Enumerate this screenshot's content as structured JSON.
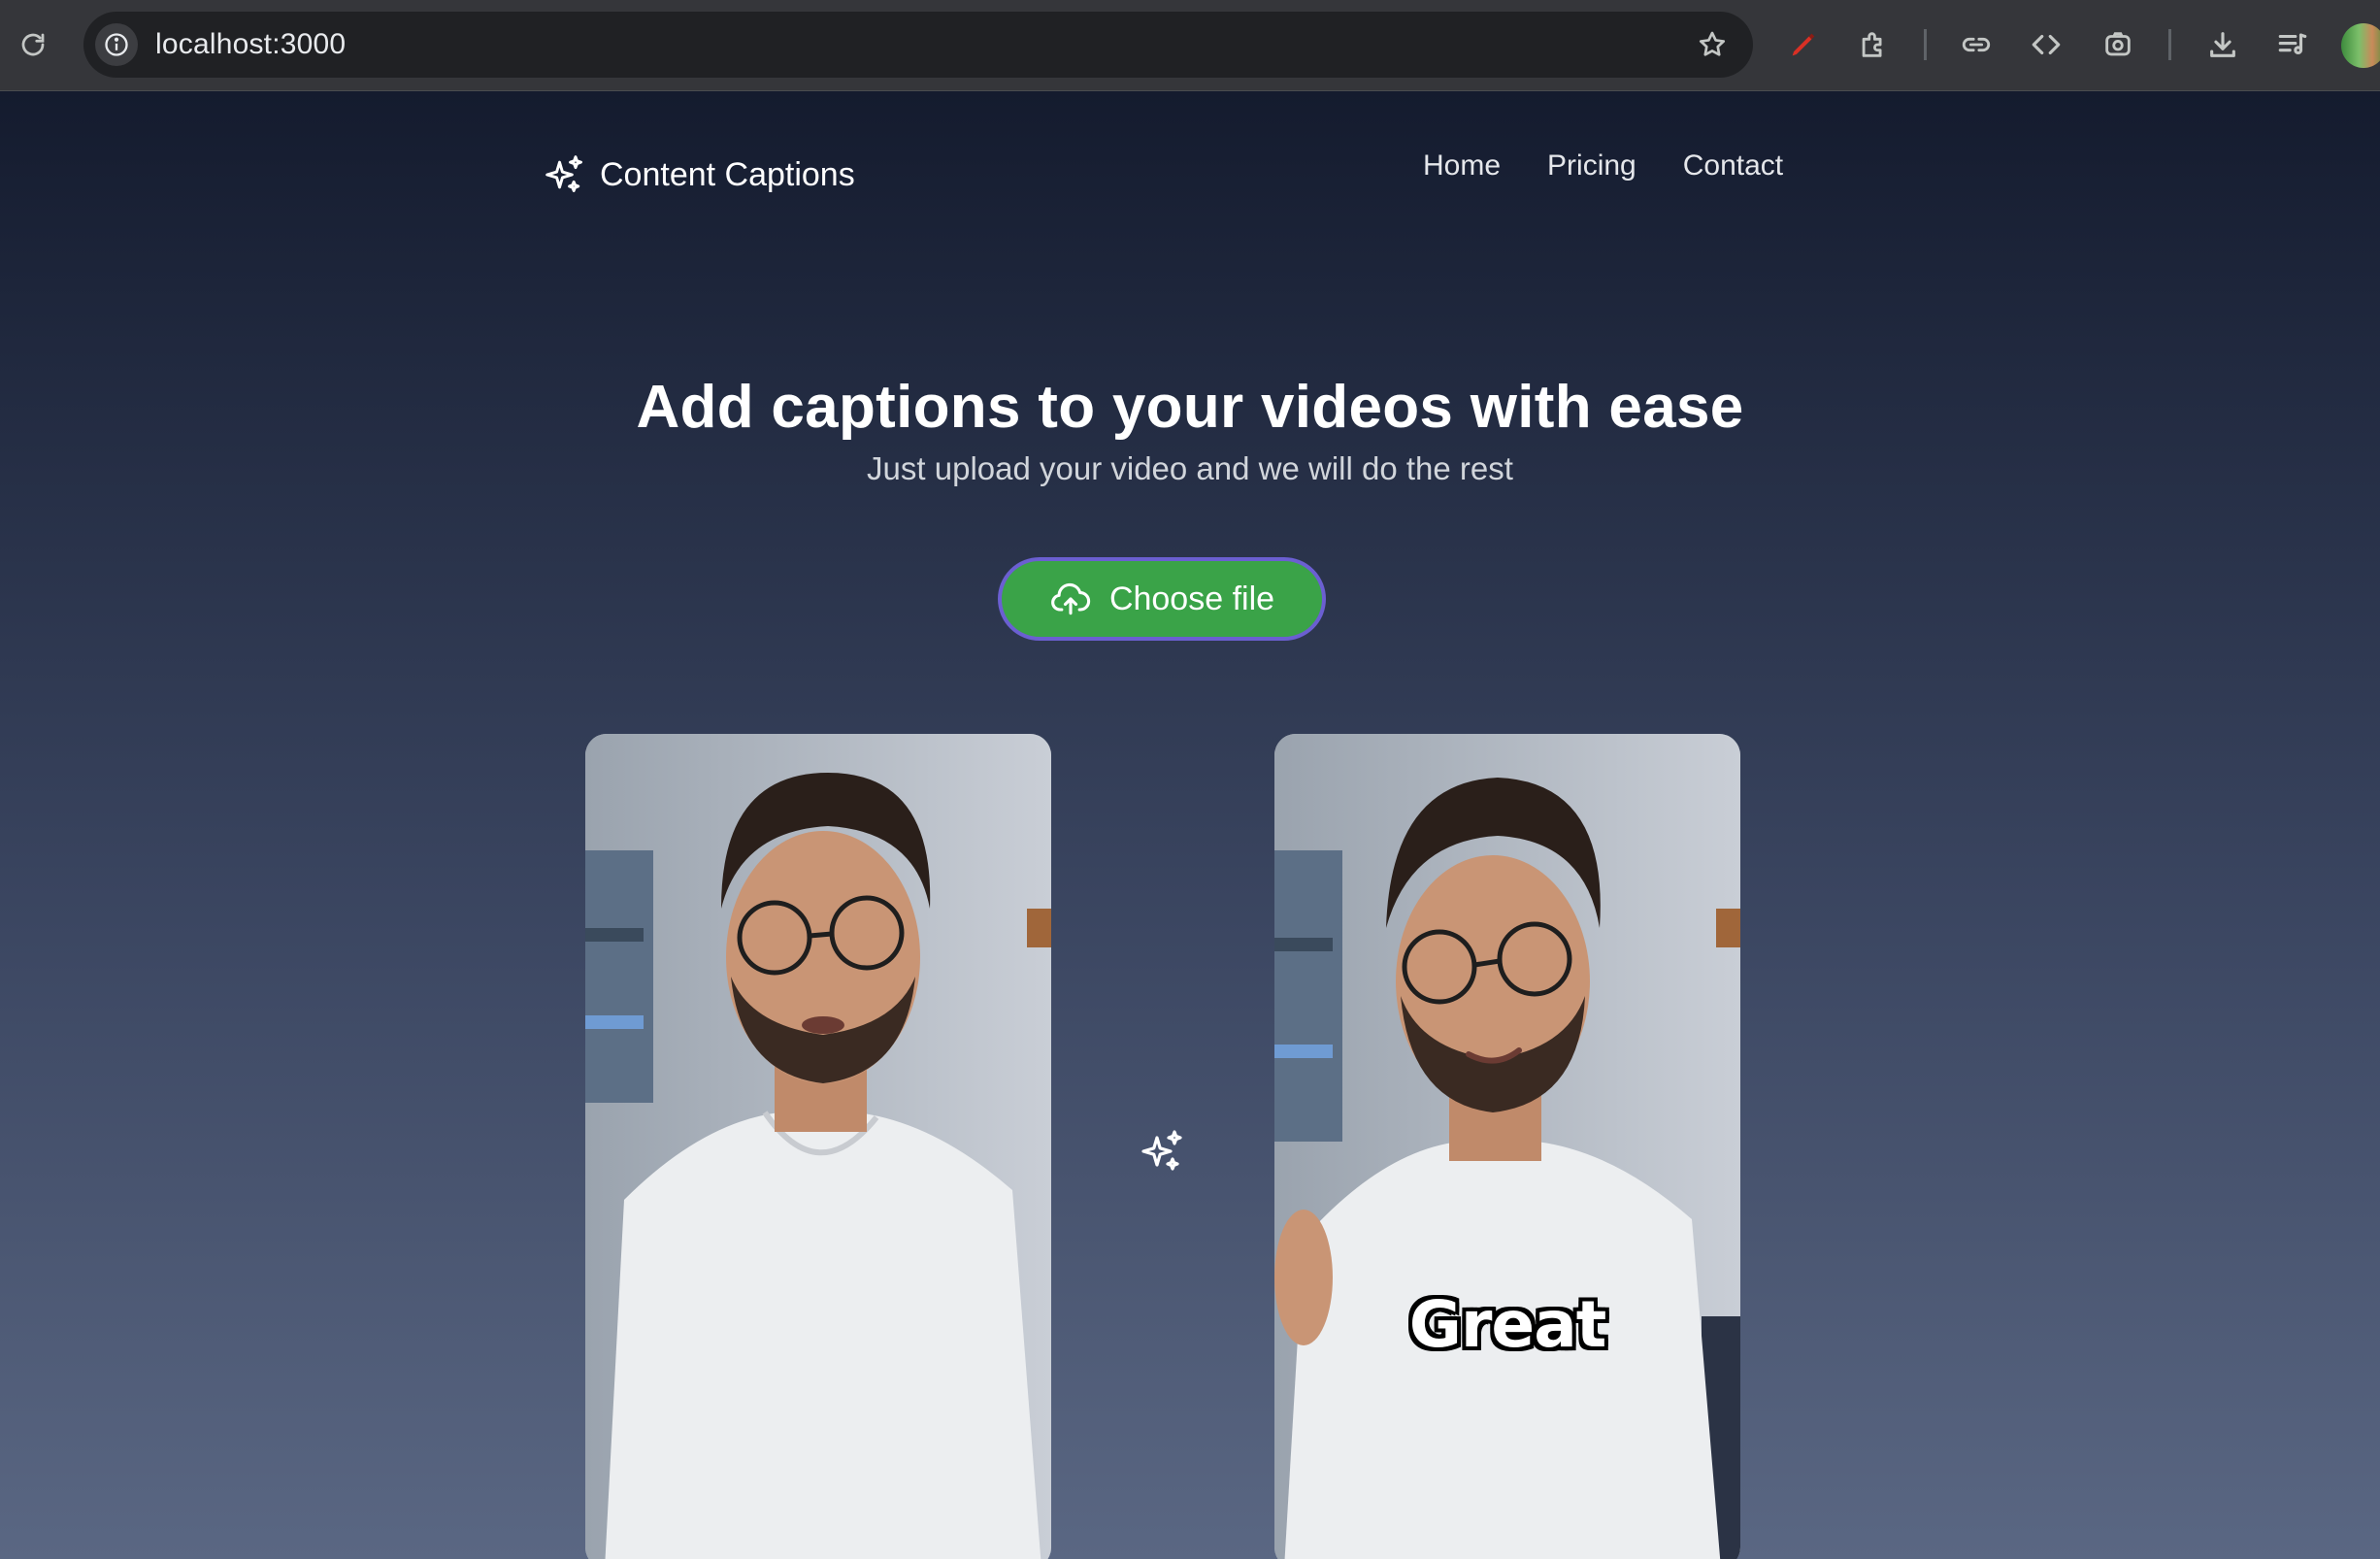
{
  "browser": {
    "url": "localhost:3000",
    "toolbar_icons": [
      "reload-icon",
      "site-info-icon",
      "bookmark-star-icon",
      "pen-extension-icon",
      "puzzle-extensions-icon",
      "link-icon",
      "code-icon",
      "screenshot-icon",
      "download-icon",
      "playlist-icon",
      "profile-avatar"
    ]
  },
  "header": {
    "brand": "Content Captions",
    "brand_icon": "sparkles-icon",
    "nav": [
      {
        "label": "Home"
      },
      {
        "label": "Pricing"
      },
      {
        "label": "Contact"
      }
    ]
  },
  "hero": {
    "title": "Add captions to your videos with ease",
    "subtitle": "Just upload your video and we will do the rest",
    "upload_button": "Choose file",
    "upload_icon": "cloud-upload-icon"
  },
  "demo": {
    "caption_word": "Great",
    "transform_icon": "sparkles-icon"
  },
  "colors": {
    "button_bg": "#3aa348",
    "button_border": "#6b5fd1",
    "page_gradient_top": "#141b2e",
    "page_gradient_bottom": "#5a6783"
  }
}
